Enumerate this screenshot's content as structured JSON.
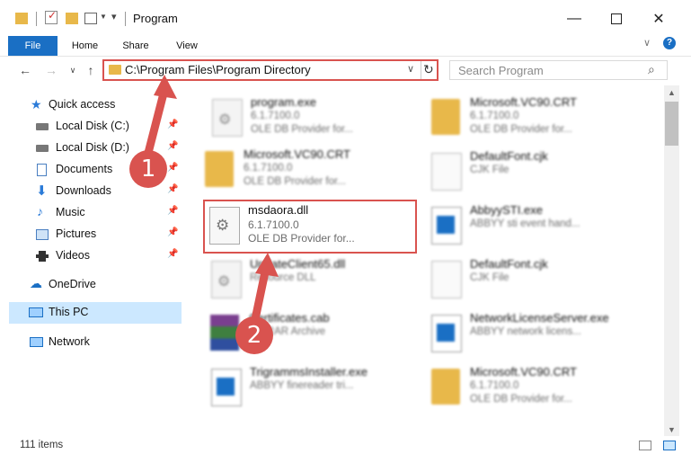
{
  "window": {
    "title": "Program"
  },
  "ribbon": {
    "tabs": [
      "File",
      "Home",
      "Share",
      "View"
    ],
    "help_label": "?"
  },
  "address_bar": {
    "path": "C:\\Program Files\\Program Directory"
  },
  "search": {
    "placeholder": "Search Program"
  },
  "nav_pane": {
    "items": [
      {
        "label": "Quick access",
        "icon": "star-icon",
        "pinned": false
      },
      {
        "label": "Local Disk (C:)",
        "icon": "drive-icon",
        "pinned": true
      },
      {
        "label": "Local Disk (D:)",
        "icon": "drive-icon",
        "pinned": true
      },
      {
        "label": "Documents",
        "icon": "documents-icon",
        "pinned": true
      },
      {
        "label": "Downloads",
        "icon": "downloads-icon",
        "pinned": true
      },
      {
        "label": "Music",
        "icon": "music-icon",
        "pinned": true
      },
      {
        "label": "Pictures",
        "icon": "pictures-icon",
        "pinned": true
      },
      {
        "label": "Videos",
        "icon": "videos-icon",
        "pinned": true
      },
      {
        "label": "OneDrive",
        "icon": "cloud-icon",
        "pinned": false
      },
      {
        "label": "This PC",
        "icon": "computer-icon",
        "pinned": false,
        "selected": true
      },
      {
        "label": "Network",
        "icon": "network-icon",
        "pinned": false
      }
    ]
  },
  "files": [
    {
      "name": "program.exe",
      "line1": "6.1.7100.0",
      "line2": "OLE DB Provider for...",
      "icon": "gear-file-icon"
    },
    {
      "name": "Microsoft.VC90.CRT",
      "line1": "6.1.7100.0",
      "line2": "OLE DB Provider for...",
      "icon": "folder-icon"
    },
    {
      "name": "Microsoft.VC90.CRT",
      "line1": "6.1.7100.0",
      "line2": "OLE DB Provider for...",
      "icon": "folder-icon"
    },
    {
      "name": "DefaultFont.cjk",
      "line1": "CJK File",
      "line2": "",
      "icon": "blank-file-icon"
    },
    {
      "name": "msdaora.dll",
      "line1": "6.1.7100.0",
      "line2": "OLE DB Provider for...",
      "icon": "gear-file-icon",
      "highlighted": true
    },
    {
      "name": "AbbyySTI.exe",
      "line1": "ABBYY sti event hand...",
      "line2": "",
      "icon": "app-icon"
    },
    {
      "name": "UpdateClient65.dll",
      "line1": "Resource DLL",
      "line2": "",
      "icon": "gear-file-icon"
    },
    {
      "name": "DefaultFont.cjk",
      "line1": "CJK File",
      "line2": "",
      "icon": "blank-file-icon"
    },
    {
      "name": "Certificates.cab",
      "line1": "WinRAR Archive",
      "line2": "",
      "icon": "archive-icon"
    },
    {
      "name": "NetworkLicenseServer.exe",
      "line1": "ABBYY network licens...",
      "line2": "",
      "icon": "app-icon"
    },
    {
      "name": "TrigrammsInstaller.exe",
      "line1": "ABBYY finereader tri...",
      "line2": "",
      "icon": "app-icon"
    },
    {
      "name": "Microsoft.VC90.CRT",
      "line1": "6.1.7100.0",
      "line2": "OLE DB Provider for...",
      "icon": "folder-icon"
    }
  ],
  "status_bar": {
    "item_count": "111 items"
  },
  "callouts": [
    "1",
    "2"
  ],
  "colors": {
    "accent": "#1a6fc4",
    "highlight_red": "#d9534f",
    "selection": "#cce8ff",
    "folder": "#e8b84a"
  }
}
